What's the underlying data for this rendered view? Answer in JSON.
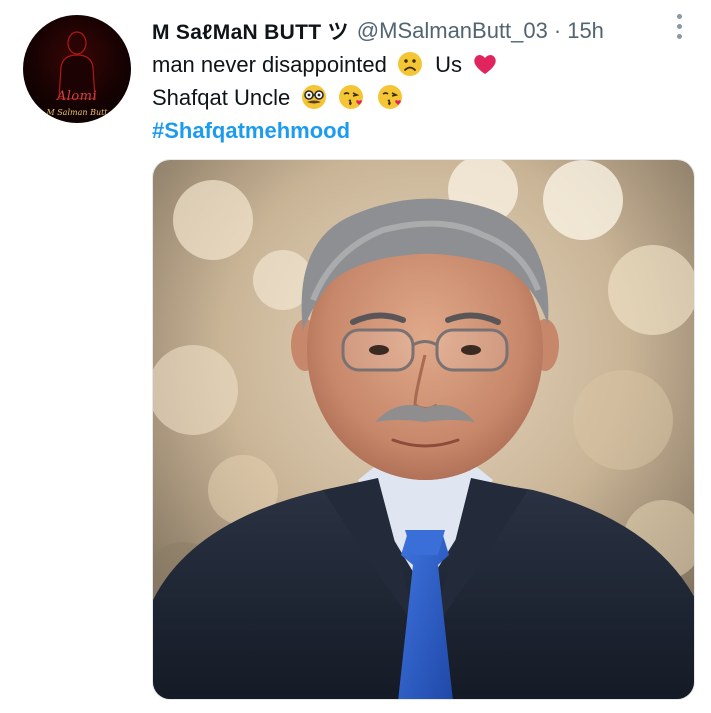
{
  "tweet": {
    "display_name": "M SaℓMaN BUTT ツ",
    "handle": "@MSalmanButt_03",
    "separator": "·",
    "time": "15h",
    "avatar": {
      "logo_text": "Alomi",
      "logo_subtext": "M Salman Butt"
    },
    "lines": {
      "line1_text": "man never disappointed",
      "line1_suffix": "Us",
      "line2_text": "Shafqat Uncle",
      "hashtag": "#Shafqatmehmood"
    },
    "icons": {
      "more": "more-vertical-icon",
      "frown": "slightly-frowning-face-icon",
      "heart": "red-heart-icon",
      "nerd": "disguised-glasses-face-icon",
      "kiss": "face-blowing-kiss-icon"
    },
    "colors": {
      "link": "#1d9bf0",
      "text": "#0f1419",
      "secondary": "#536471",
      "heart": "#e0245e",
      "suit": "#1b2230",
      "tie": "#2f5ec9",
      "shirt": "#dfe6f2"
    }
  }
}
